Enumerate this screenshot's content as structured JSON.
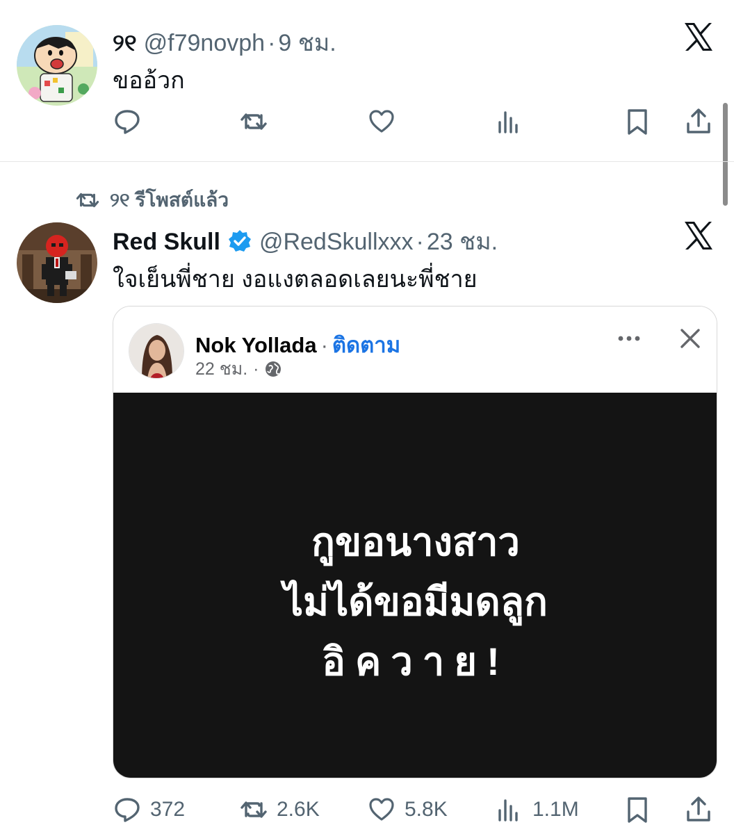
{
  "tweet1": {
    "display_name": "୨୧",
    "handle": "@f79novph",
    "separator": "·",
    "time": "9 ชม.",
    "text": "ขออ้วก"
  },
  "repost": {
    "label": "୨୧ รีโพสต์แล้ว"
  },
  "tweet2": {
    "display_name": "Red Skull",
    "handle": "@RedSkullxxx",
    "separator": "·",
    "time": "23 ชม.",
    "text": "ใจเย็นพี่ชาย งอแงตลอดเลยนะพี่ชาย",
    "card": {
      "author": "Nok Yollada",
      "dot": "·",
      "follow_label": "ติดตาม",
      "time": "22 ชม.",
      "meta_sep": "·",
      "image_lines": [
        "กูขอนางสาว",
        "ไม่ได้ขอมีมดลูก",
        "อิควาย!"
      ]
    },
    "stats": {
      "replies": "372",
      "reposts": "2.6K",
      "likes": "5.8K",
      "views": "1.1M"
    }
  },
  "icons": {
    "close": "x-logo-icon",
    "verified": "verified-badge-icon",
    "accent": "#1d9bf0",
    "muted": "#536471"
  }
}
